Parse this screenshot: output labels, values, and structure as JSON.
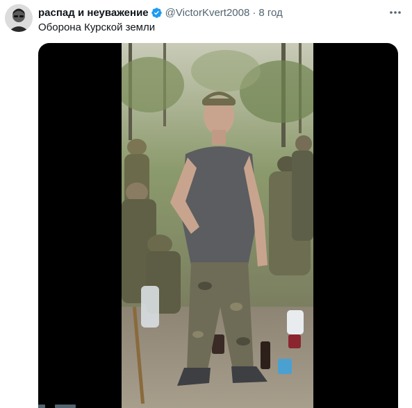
{
  "tweet": {
    "author": {
      "display_name": "распад и неуважение",
      "handle": "@VictorKvert2008",
      "verified": true
    },
    "separator": "·",
    "time": "8 год",
    "text": "Оборона Курской земли"
  },
  "icons": {
    "verified": "verified-badge-icon",
    "more": "more-options-icon"
  },
  "colors": {
    "verified_blue": "#1d9bf0",
    "secondary_text": "#536471",
    "primary_text": "#0f1419"
  }
}
